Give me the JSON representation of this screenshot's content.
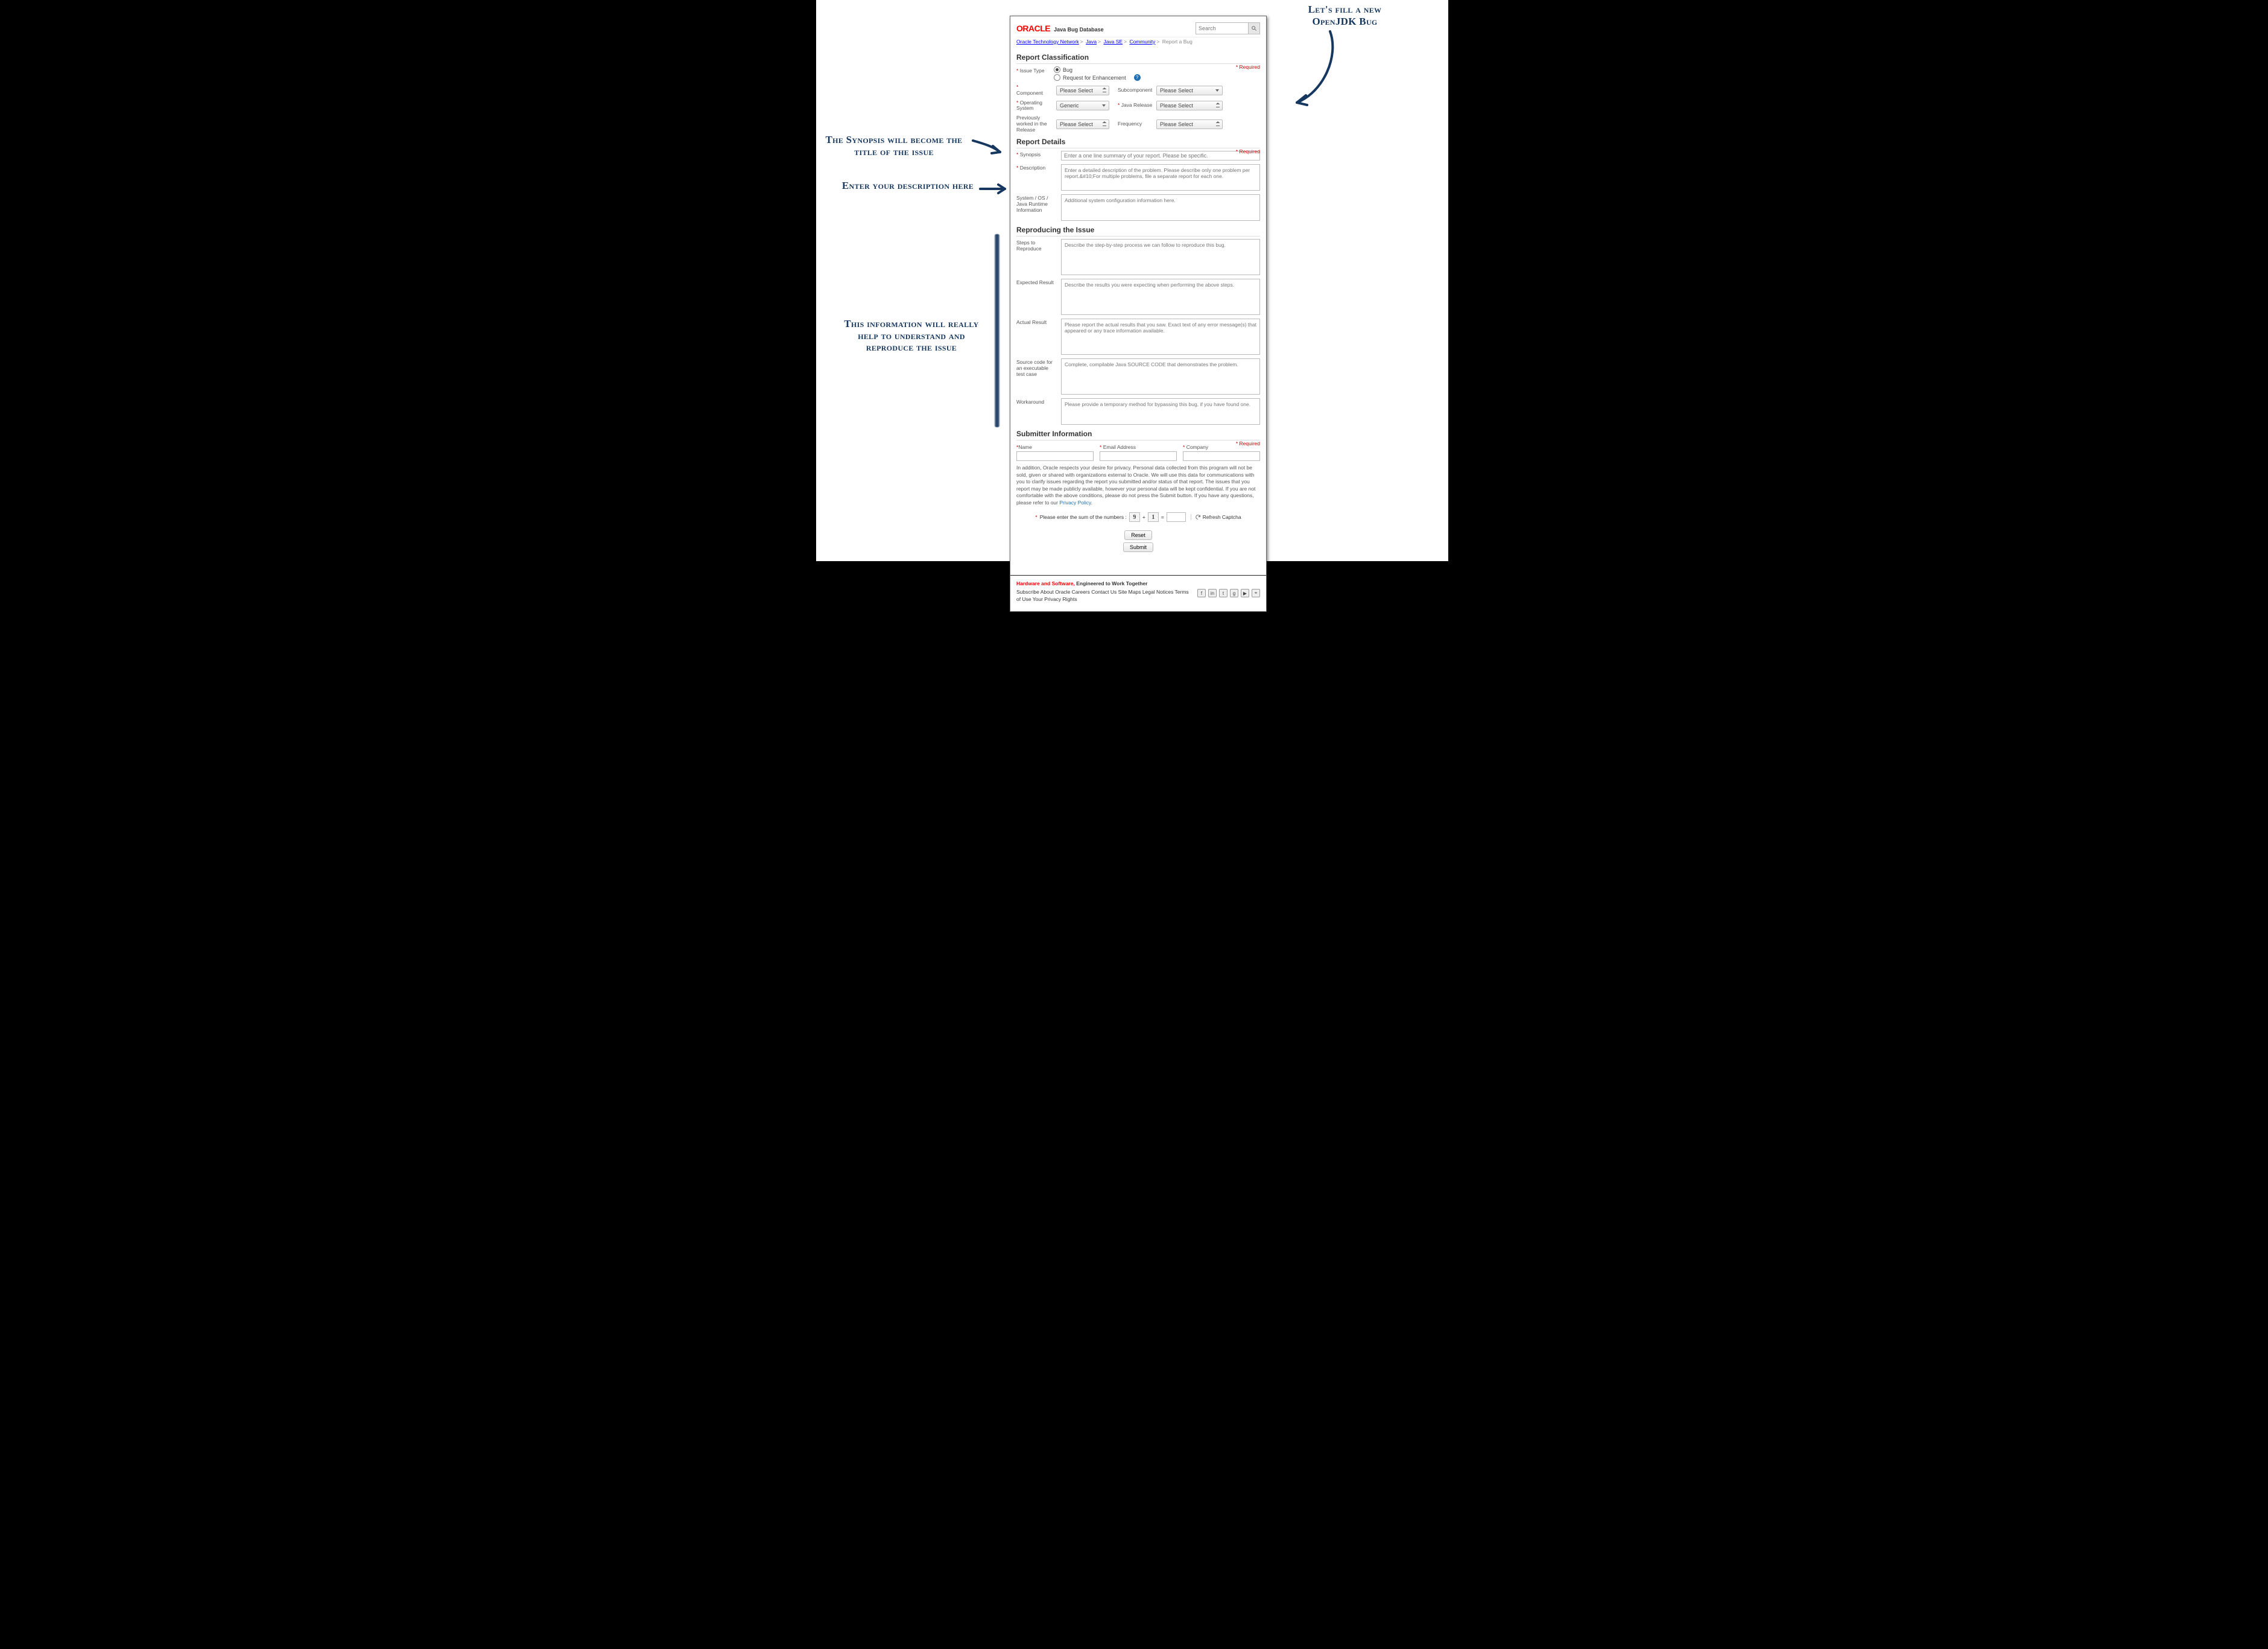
{
  "annotations": {
    "top_right": "Let's fill a new OpenJDK Bug",
    "synopsis": "The Synopsis will become the title of the issue",
    "description": "Enter your description here",
    "reproduce": "This information will really help to understand and reproduce the issue"
  },
  "header": {
    "logo_text": "ORACLE",
    "logo_sub": "Java Bug Database",
    "search_placeholder": "Search"
  },
  "breadcrumb": {
    "items": [
      "Oracle Technology Network",
      "Java",
      "Java SE",
      "Community"
    ],
    "current": "Report a Bug"
  },
  "required_label": "* Required",
  "sections": {
    "classification": {
      "title": "Report Classification",
      "issue_type_label": "Issue Type",
      "issue_type_options": [
        "Bug",
        "Request for Enhancement"
      ],
      "component_label": "Component",
      "subcomponent_label": "Subcomponent",
      "os_label": "Operating System",
      "java_release_label": "Java Release",
      "prev_release_label": "Previously worked in the Release",
      "frequency_label": "Frequency",
      "please_select": "Please Select",
      "generic": "Generic"
    },
    "details": {
      "title": "Report Details",
      "synopsis_label": "Synopsis",
      "synopsis_ph": "Enter a one line summary of your report. Please be specific.",
      "description_label": "Description",
      "description_ph": "Enter a detailed description of the problem. Please describe only one problem per report.&#10;For multiple problems, file a separate report for each one.",
      "runtime_label": "System / OS / Java Runtime Information",
      "runtime_ph": "Additional system configuration information here."
    },
    "reproduce": {
      "title": "Reproducing the Issue",
      "steps_label": "Steps to Reproduce",
      "steps_ph": "Describe the step-by-step process we can follow to reproduce this bug.",
      "expected_label": "Expected Result",
      "expected_ph": "Describe the results you were expecting when performing the above steps.",
      "actual_label": "Actual Result",
      "actual_ph": "Please report the actual results that you saw. Exact text of any error message(s) that appeared or any trace information available.",
      "source_label": "Source code for an executable test case",
      "source_ph": "Complete, compilable Java SOURCE CODE that demonstrates the problem.",
      "workaround_label": "Workaround",
      "workaround_ph": "Please provide a temporary method for bypassing this bug, if you have found one."
    },
    "submitter": {
      "title": "Submitter Information",
      "name_label": "Name",
      "email_label": "Email Address",
      "company_label": "Company",
      "privacy_text": "In addition, Oracle respects your desire for privacy. Personal data collected from this program will not be sold, given or shared with organizations external to Oracle. We will use this data for communications with you to clarify issues regarding the report you submitted and/or status of that report. The issues that you report may be made publicly available, however your personal data will be kept confidential. If you are not comfortable with the above conditions, please do not press the Submit button. If you have any questions, please refer to our ",
      "privacy_link": "Privacy Policy",
      "captcha_prompt": "Please enter the sum of the numbers :",
      "captcha_a": "9",
      "captcha_b": "1",
      "refresh_label": "Refresh Captcha",
      "reset": "Reset",
      "submit": "Submit"
    }
  },
  "footer": {
    "tag1": "Hardware and Software,",
    "tag2": "Engineered to Work Together",
    "links": "Subscribe About Oracle Careers Contact Us Site Maps Legal Notices Terms of Use Your Privacy Rights"
  }
}
